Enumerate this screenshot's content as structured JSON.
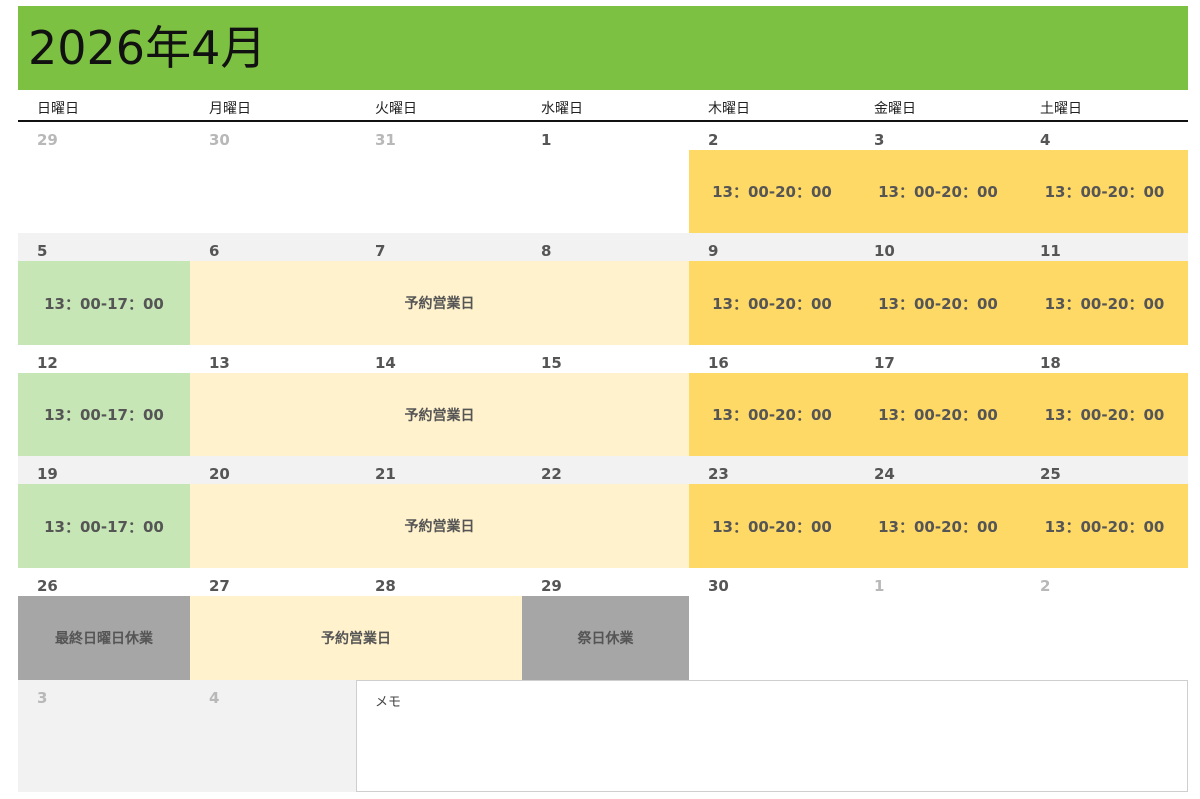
{
  "title": "2026年4月",
  "weekdays": [
    "日曜日",
    "月曜日",
    "火曜日",
    "水曜日",
    "木曜日",
    "金曜日",
    "土曜日"
  ],
  "colors": {
    "header": "#7cc142",
    "weekday_hours": "#ffd966",
    "sunday_hours": "#c6e6b5",
    "reservation": "#fff2cc",
    "closed": "#a6a6a6",
    "band": "#f2f2f2"
  },
  "weeks": [
    {
      "dates": [
        "29",
        "30",
        "31",
        "1",
        "2",
        "3",
        "4"
      ],
      "muted": [
        true,
        true,
        true,
        false,
        false,
        false,
        false
      ]
    },
    {
      "dates": [
        "5",
        "6",
        "7",
        "8",
        "9",
        "10",
        "11"
      ],
      "muted": [
        false,
        false,
        false,
        false,
        false,
        false,
        false
      ]
    },
    {
      "dates": [
        "12",
        "13",
        "14",
        "15",
        "16",
        "17",
        "18"
      ],
      "muted": [
        false,
        false,
        false,
        false,
        false,
        false,
        false
      ]
    },
    {
      "dates": [
        "19",
        "20",
        "21",
        "22",
        "23",
        "24",
        "25"
      ],
      "muted": [
        false,
        false,
        false,
        false,
        false,
        false,
        false
      ]
    },
    {
      "dates": [
        "26",
        "27",
        "28",
        "29",
        "30",
        "1",
        "2"
      ],
      "muted": [
        false,
        false,
        false,
        false,
        false,
        true,
        true
      ]
    },
    {
      "dates": [
        "3",
        "4"
      ],
      "muted": [
        true,
        true
      ]
    }
  ],
  "hours": {
    "weekday": "13：00-20：00",
    "sunday": "13：00-17：00"
  },
  "labels": {
    "reservation": "予約営業日",
    "last_sunday_closed": "最終日曜日休業",
    "holiday_closed": "祭日休業"
  },
  "memo_label": "メモ"
}
